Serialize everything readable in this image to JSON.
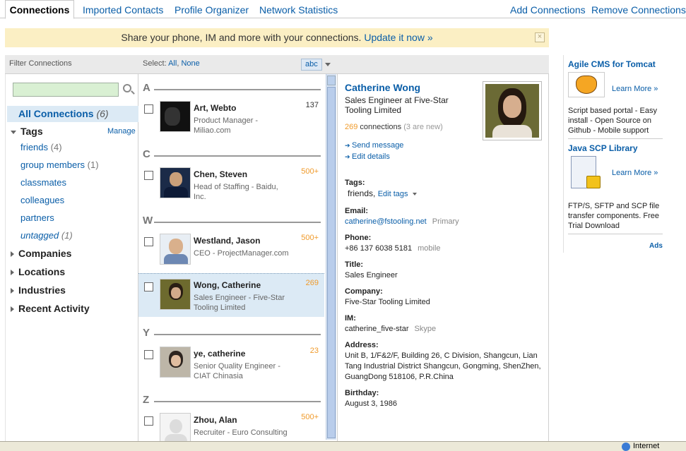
{
  "tabs": {
    "connections": "Connections",
    "imported": "Imported Contacts",
    "profile_organizer": "Profile Organizer",
    "network_stats": "Network Statistics",
    "add": "Add Connections",
    "remove": "Remove Connections"
  },
  "banner": {
    "text": "Share your phone, IM and more with your connections.",
    "link": "Update it now »",
    "close": "×"
  },
  "filter": {
    "header": "Filter Connections",
    "all_label": "All Connections",
    "all_count": "(6)",
    "tags_label": "Tags",
    "manage": "Manage",
    "tags": [
      {
        "label": "friends",
        "count": "(4)"
      },
      {
        "label": "group members",
        "count": "(1)"
      },
      {
        "label": "classmates",
        "count": ""
      },
      {
        "label": "colleagues",
        "count": ""
      },
      {
        "label": "partners",
        "count": ""
      },
      {
        "label": "untagged",
        "count": "(1)"
      }
    ],
    "sections": [
      "Companies",
      "Locations",
      "Industries",
      "Recent Activity"
    ]
  },
  "list": {
    "select_label": "Select:",
    "all": "All",
    "none": "None",
    "sort": "abc",
    "letters": [
      "A",
      "C",
      "W",
      "Y",
      "Z"
    ],
    "contacts": [
      {
        "name": "Art, Webto",
        "headline": "Product Manager - Miliao.com",
        "count": "137"
      },
      {
        "name": "Chen, Steven",
        "headline": "Head of Staffing - Baidu, Inc.",
        "count": "500+"
      },
      {
        "name": "Westland, Jason",
        "headline": "CEO - ProjectManager.com",
        "count": "500+"
      },
      {
        "name": "Wong, Catherine",
        "headline": "Sales Engineer - Five-Star Tooling Limited",
        "count": "269"
      },
      {
        "name": "ye, catherine",
        "headline": "Senior Quality Engineer - CIAT Chinasia",
        "count": "23"
      },
      {
        "name": "Zhou, Alan",
        "headline": "Recruiter - Euro Consulting",
        "count": "500+"
      }
    ]
  },
  "detail": {
    "name": "Catherine Wong",
    "title": "Sales Engineer at Five-Star Tooling Limited",
    "conn_count": "269",
    "conn_label": "connections",
    "conn_new": "(3 are new)",
    "send": "Send message",
    "edit": "Edit details",
    "tags_label": "Tags:",
    "tags_value": "friends,",
    "edit_tags": "Edit tags",
    "email_label": "Email:",
    "email": "catherine@fstooling.net",
    "email_type": "Primary",
    "phone_label": "Phone:",
    "phone": "+86 137 6038 5181",
    "phone_type": "mobile",
    "title_label": "Title:",
    "title_value": "Sales Engineer",
    "company_label": "Company:",
    "company": "Five-Star Tooling Limited",
    "im_label": "IM:",
    "im": "catherine_five-star",
    "im_type": "Skype",
    "address_label": "Address:",
    "address": "Unit B, 1/F&2/F, Building 26, C Division, Shangcun, Lian Tang Industrial District Shangcun, Gongming, ShenZhen, GuangDong 518106, P.R.China",
    "birthday_label": "Birthday:",
    "birthday": "August 3, 1986"
  },
  "ads": {
    "ad1_title": "Agile CMS for Tomcat",
    "ad1_more": "Learn More »",
    "ad1_text": "Script based portal - Easy install - Open Source on Github - Mobile support",
    "ad2_title": "Java SCP Library",
    "ad2_more": "Learn More »",
    "ad2_text": "FTP/S, SFTP and SCP file transfer components. Free Trial Download",
    "ads_label": "Ads"
  },
  "statusbar": {
    "zone": "Internet"
  }
}
